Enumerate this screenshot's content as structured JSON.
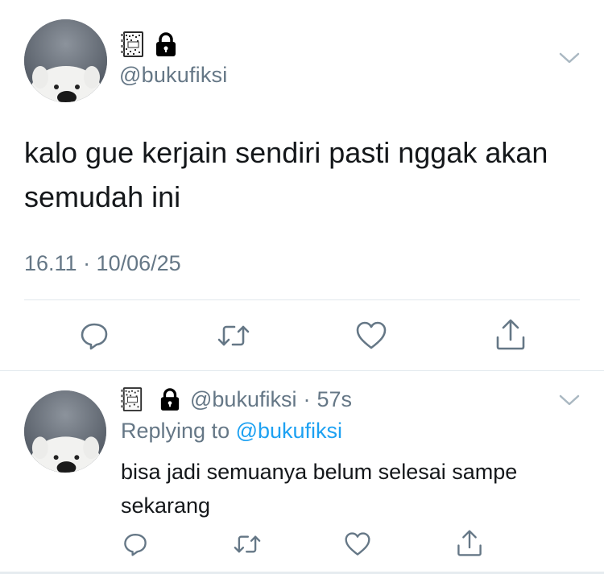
{
  "tweet": {
    "handle": "@bukufiksi",
    "text": "kalo gue kerjain sendiri pasti nggak akan semudah ini",
    "timestamp": "16.11 · 10/06/25"
  },
  "reply": {
    "handle": "@bukufiksi",
    "separator": "·",
    "time": "57s",
    "replying_prefix": "Replying to ",
    "replying_to": "@bukufiksi",
    "text": "bisa jadi semuanya belum selesai sampe sekarang"
  },
  "icons": {
    "badge": "notebook-icon",
    "lock": "lock-icon",
    "more": "chevron-down-icon",
    "reply": "reply-icon",
    "retweet": "retweet-icon",
    "like": "heart-icon",
    "share": "share-icon"
  },
  "colors": {
    "text": "#14171a",
    "secondary": "#657786",
    "link": "#1da1f2",
    "divider": "#e1e8ed"
  }
}
